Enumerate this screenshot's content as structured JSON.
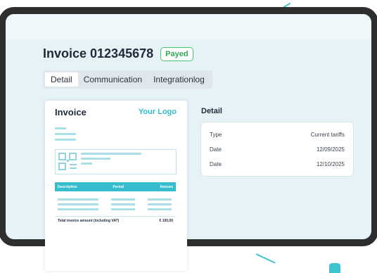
{
  "invoice": {
    "title": "Invoice 012345678",
    "status_badge": "Payed"
  },
  "tabs": [
    {
      "label": "Detail",
      "active": true
    },
    {
      "label": "Communication",
      "active": false
    },
    {
      "label": "Integrationlog",
      "active": false
    }
  ],
  "detail": {
    "heading": "Detail",
    "rows": [
      {
        "label": "Type",
        "value": "Current tariffs"
      },
      {
        "label": "Date",
        "value": "12/09/2025"
      },
      {
        "label": "Date",
        "value": "12/10/2025"
      }
    ]
  },
  "preview": {
    "title": "Invoice",
    "logo_text": "Your Logo",
    "table_headers": [
      "Description",
      "Period",
      "Amount"
    ],
    "total_label": "Total invoice amount (including VAT)",
    "total_value": "€ 100,00"
  },
  "colors": {
    "accent": "#36bdcd",
    "badge_green": "#2faa53",
    "frame": "#2e2e2e",
    "screen_bg": "#e6f3f6"
  }
}
